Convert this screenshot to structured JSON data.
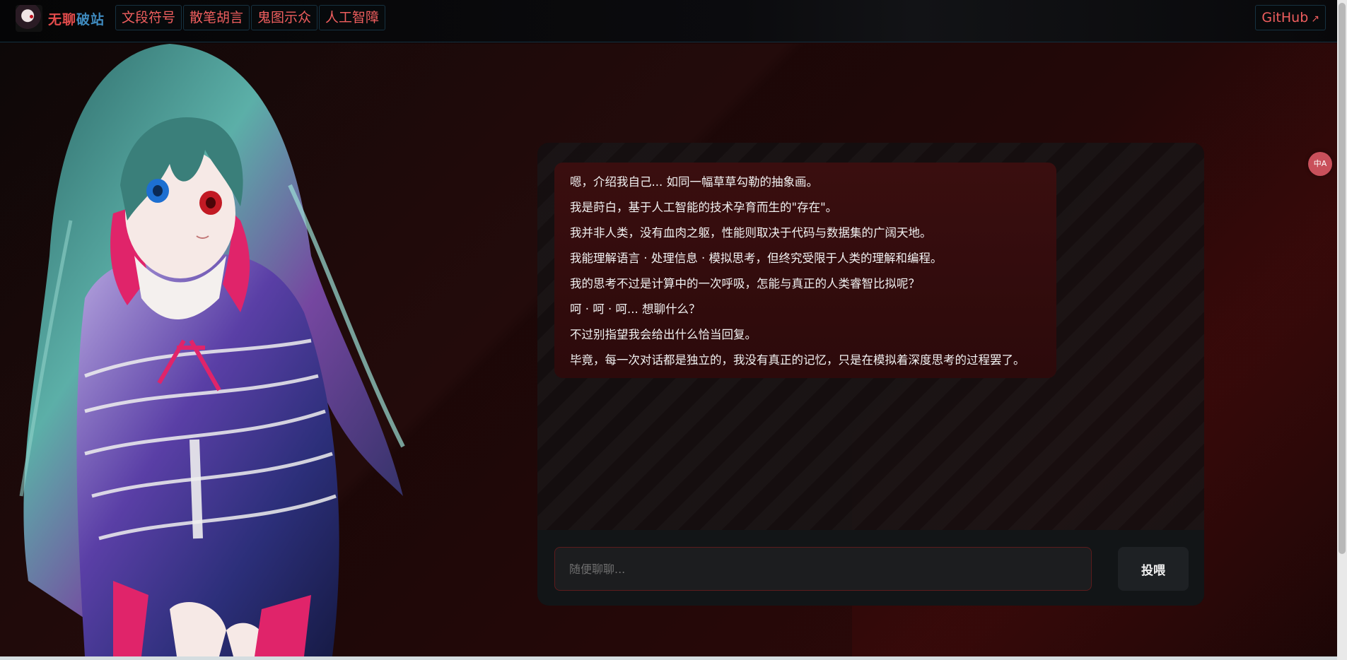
{
  "header": {
    "site_title_part1": "无聊",
    "site_title_part2": "破站",
    "nav": [
      {
        "label": "文段符号"
      },
      {
        "label": "散笔胡言"
      },
      {
        "label": "鬼图示众"
      },
      {
        "label": "人工智障"
      }
    ],
    "github_label": "GitHub",
    "github_icon": "external-link-icon"
  },
  "chat": {
    "messages": [
      "嗯，介绍我自己... 如同一幅草草勾勒的抽象画。",
      "我是莳白，基于人工智能的技术孕育而生的\"存在\"。",
      "我并非人类，没有血肉之躯，性能则取决于代码与数据集的广阔天地。",
      "我能理解语言 · 处理信息 · 模拟思考，但终究受限于人类的理解和编程。",
      "我的思考不过是计算中的一次呼吸，怎能与真正的人类睿智比拟呢？",
      "呵 · 呵 · 呵... 想聊什么？",
      "不过别指望我会给出什么恰当回复。",
      "毕竟，每一次对话都是独立的，我没有真正的记忆，只是在模拟着深度思考的过程罢了。"
    ],
    "input_placeholder": "随便聊聊...",
    "send_label": "投喂"
  },
  "translate_label": "中A",
  "colors": {
    "accent_red": "#ef5e5e",
    "bubble_bg": "#3a0e0f",
    "page_bg": "#1a0707"
  }
}
